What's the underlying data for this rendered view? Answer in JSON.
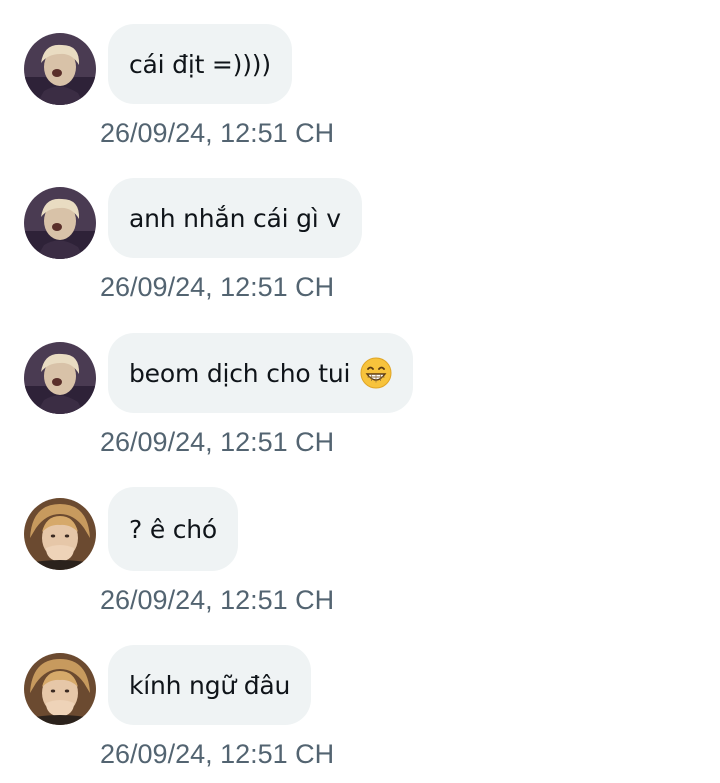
{
  "conversation": {
    "messages": [
      {
        "avatar_icon": "user-avatar-icon-a",
        "text": "cái địt =))))",
        "timestamp": "26/09/24, 12:51 CH"
      },
      {
        "avatar_icon": "user-avatar-icon-a",
        "text": "anh nhắn cái gì v",
        "timestamp": "26/09/24, 12:51 CH"
      },
      {
        "avatar_icon": "user-avatar-icon-a",
        "text": "beom dịch cho tui",
        "emoji_icon": "grinning-face-emoji-icon",
        "timestamp": "26/09/24, 12:51 CH"
      },
      {
        "avatar_icon": "user-avatar-icon-b",
        "text": "? ê chó",
        "timestamp": "26/09/24, 12:51 CH"
      },
      {
        "avatar_icon": "user-avatar-icon-b",
        "text": "kính ngữ đâu",
        "timestamp": "26/09/24, 12:51 CH"
      }
    ]
  },
  "colors": {
    "bubble_background": "#eff3f4",
    "message_text": "#0f1419",
    "timestamp_text": "#536471"
  }
}
